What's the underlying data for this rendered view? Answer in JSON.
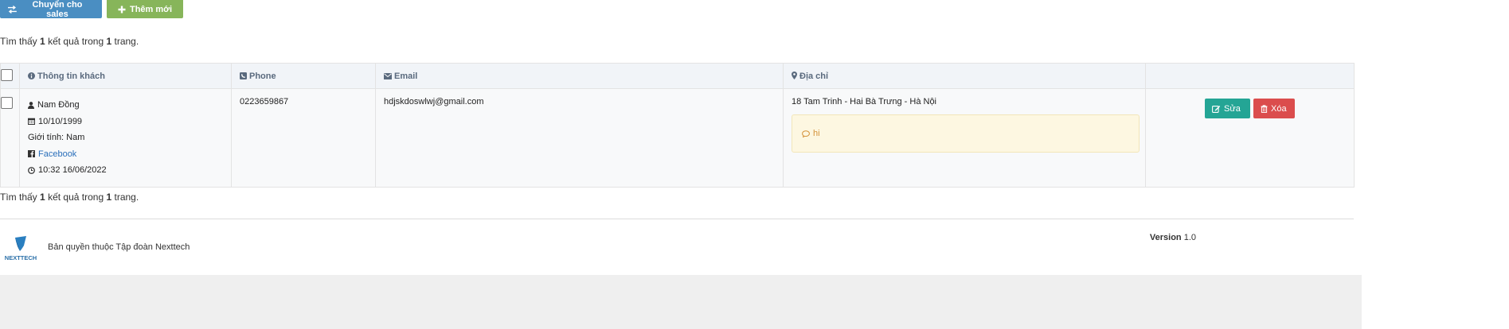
{
  "toolbar": {
    "transfer_label": "Chuyển cho sales",
    "add_label": "Thêm mới",
    "colors": {
      "transfer": "#4a8ec2",
      "add": "#87b55a"
    }
  },
  "summary": {
    "prefix": "Tìm thấy",
    "count": "1",
    "middle": "kết quả trong",
    "pages": "1",
    "suffix": "trang."
  },
  "table": {
    "headers": {
      "customer": "Thông tin khách",
      "phone": "Phone",
      "email": "Email",
      "address": "Địa chỉ"
    },
    "rows": [
      {
        "name": "Nam Đồng",
        "birthday": "10/10/1999",
        "gender": "Giới tính: Nam",
        "social": "Facebook",
        "created": "10:32 16/06/2022",
        "phone": "0223659867",
        "email": "hdjskdoswlwj@gmail.com",
        "address": "18 Tam Trinh - Hai Bà Trưng - Hà Nội",
        "note": "hi",
        "edit_label": "Sửa",
        "delete_label": "Xóa"
      }
    ],
    "icons": [
      "info-circle-icon",
      "phone-icon",
      "envelope-icon",
      "map-marker-icon",
      "user-icon",
      "calendar-icon",
      "facebook-icon",
      "clock-icon",
      "comment-icon",
      "edit-icon",
      "trash-icon"
    ],
    "colors": {
      "edit": "#24a595",
      "delete": "#db4d4d",
      "note_bg": "#fdf7e1"
    }
  },
  "footer": {
    "logo_text": "NEXTTECH",
    "copyright": "Bản quyền thuộc Tập đoàn Nexttech",
    "version_label": "Version",
    "version_value": "1.0"
  }
}
